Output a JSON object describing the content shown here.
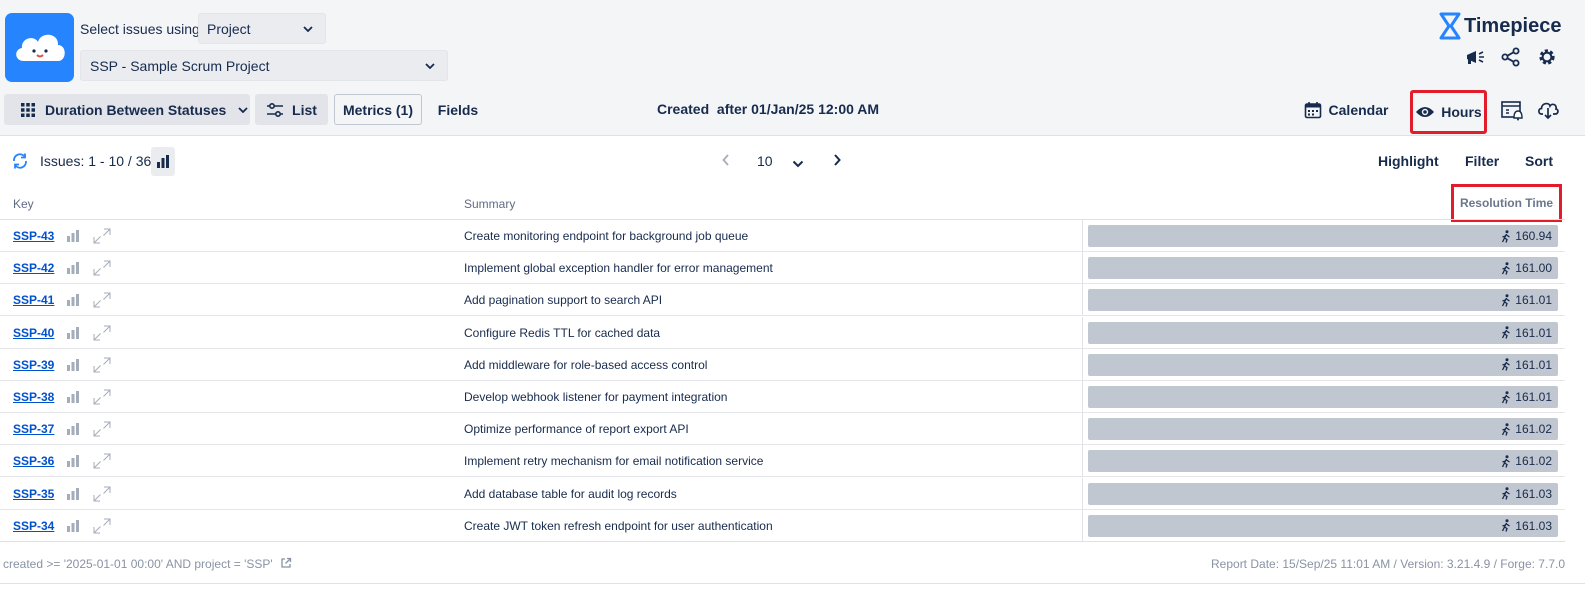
{
  "header": {
    "select_label": "Select issues using",
    "select_mode": "Project",
    "project": "SSP - Sample Scrum Project",
    "brand": "Timepiece",
    "report_type": "Duration Between Statuses",
    "list_label": "List",
    "metrics_label": "Metrics (1)",
    "fields_label": "Fields",
    "created_filter": "Created  after 01/Jan/25 12:00 AM",
    "calendar_label": "Calendar",
    "hours_label": "Hours"
  },
  "toolbar": {
    "issues_label": "Issues: 1 - 10 / 36",
    "page_size": "10",
    "highlight": "Highlight",
    "filter": "Filter",
    "sort": "Sort"
  },
  "columns": {
    "key": "Key",
    "summary": "Summary",
    "resolution": "Resolution Time"
  },
  "rows": [
    {
      "key": "SSP-43",
      "summary": "Create monitoring endpoint for background job queue",
      "value": "160.94"
    },
    {
      "key": "SSP-42",
      "summary": "Implement global exception handler for error management",
      "value": "161.00"
    },
    {
      "key": "SSP-41",
      "summary": "Add pagination support to search API",
      "value": "161.01"
    },
    {
      "key": "SSP-40",
      "summary": "Configure Redis TTL for cached data",
      "value": "161.01"
    },
    {
      "key": "SSP-39",
      "summary": "Add middleware for role-based access control",
      "value": "161.01"
    },
    {
      "key": "SSP-38",
      "summary": "Develop webhook listener for payment integration",
      "value": "161.01"
    },
    {
      "key": "SSP-37",
      "summary": "Optimize performance of report export API",
      "value": "161.02"
    },
    {
      "key": "SSP-36",
      "summary": "Implement retry mechanism for email notification service",
      "value": "161.02"
    },
    {
      "key": "SSP-35",
      "summary": "Add database table for audit log records",
      "value": "161.03"
    },
    {
      "key": "SSP-34",
      "summary": "Create JWT token refresh endpoint for user authentication",
      "value": "161.03"
    }
  ],
  "footer": {
    "jql": "created >= '2025-01-01 00:00' AND project = 'SSP'",
    "report": "Report Date: 15/Sep/25 11:01 AM / Version: 3.21.4.9 / Forge: 7.7.0"
  },
  "colors": {
    "accent": "#2684ff",
    "highlight_box": "#e11d2b",
    "bar": "#c1c7d0",
    "link": "#0052cc"
  }
}
